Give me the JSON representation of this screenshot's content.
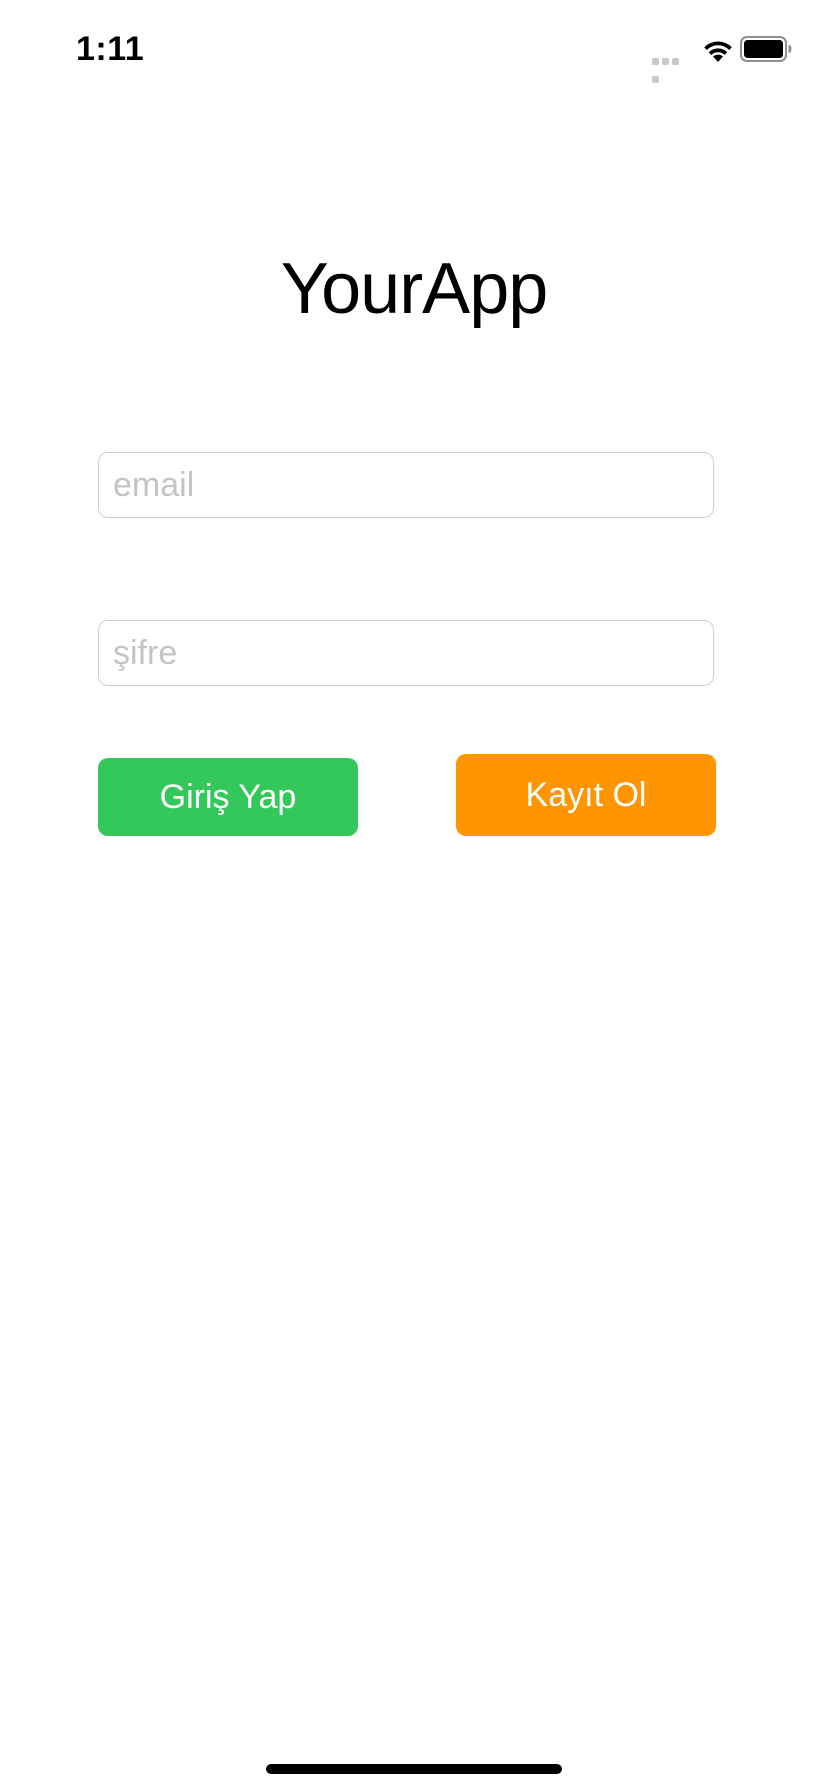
{
  "status_bar": {
    "time": "1:11",
    "icons": [
      "cellular-signal-icon",
      "wifi-icon",
      "battery-icon"
    ]
  },
  "app": {
    "title": "YourApp"
  },
  "form": {
    "email_placeholder": "email",
    "password_placeholder": "şifre",
    "email_value": "",
    "password_value": ""
  },
  "buttons": {
    "login_label": "Giriş Yap",
    "register_label": "Kayıt Ol"
  },
  "colors": {
    "login_button": "#34c759",
    "register_button": "#ff9500",
    "placeholder_text": "#c4c4c8",
    "background": "#ffffff"
  }
}
